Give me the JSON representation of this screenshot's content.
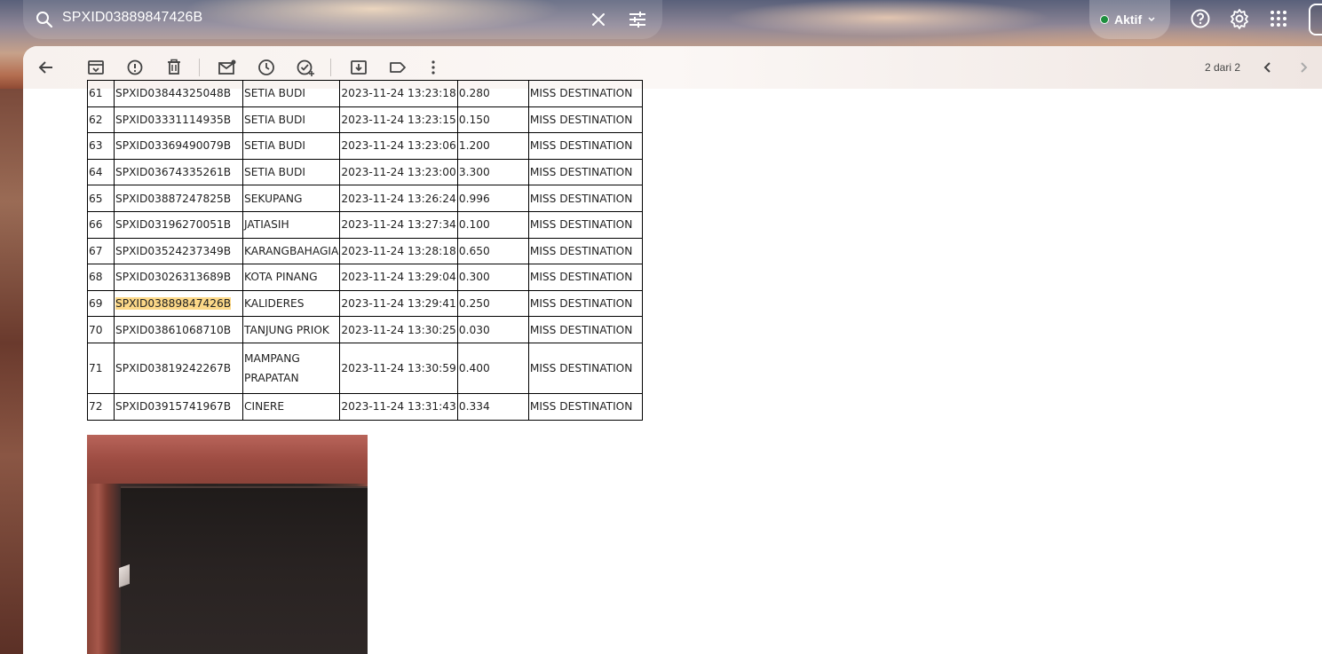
{
  "search": {
    "query": "SPXID03889847426B"
  },
  "status": {
    "label": "Aktif"
  },
  "pager": {
    "text": "2 dari 2"
  },
  "table": {
    "rows": [
      {
        "no": "61",
        "id": "SPXID03844325048B",
        "loc": "SETIA BUDI",
        "time": "2023-11-24 13:23:18",
        "weight": "0.280",
        "status": "MISS DESTINATION"
      },
      {
        "no": "62",
        "id": "SPXID03331114935B",
        "loc": "SETIA BUDI",
        "time": "2023-11-24 13:23:15",
        "weight": "0.150",
        "status": "MISS DESTINATION"
      },
      {
        "no": "63",
        "id": "SPXID03369490079B",
        "loc": "SETIA BUDI",
        "time": "2023-11-24 13:23:06",
        "weight": "1.200",
        "status": "MISS DESTINATION"
      },
      {
        "no": "64",
        "id": "SPXID03674335261B",
        "loc": "SETIA BUDI",
        "time": "2023-11-24 13:23:00",
        "weight": "3.300",
        "status": "MISS DESTINATION"
      },
      {
        "no": "65",
        "id": "SPXID03887247825B",
        "loc": "SEKUPANG",
        "time": "2023-11-24 13:26:24",
        "weight": "0.996",
        "status": "MISS DESTINATION"
      },
      {
        "no": "66",
        "id": "SPXID03196270051B",
        "loc": "JATIASIH",
        "time": "2023-11-24 13:27:34",
        "weight": "0.100",
        "status": "MISS DESTINATION"
      },
      {
        "no": "67",
        "id": "SPXID03524237349B",
        "loc": "KARANGBAHAGIA",
        "time": "2023-11-24 13:28:18",
        "weight": "0.650",
        "status": "MISS DESTINATION"
      },
      {
        "no": "68",
        "id": "SPXID03026313689B",
        "loc": "KOTA PINANG",
        "time": "2023-11-24 13:29:04",
        "weight": "0.300",
        "status": "MISS DESTINATION"
      },
      {
        "no": "69",
        "id": "SPXID03889847426B",
        "loc": "KALIDERES",
        "time": "2023-11-24 13:29:41",
        "weight": "0.250",
        "status": "MISS DESTINATION"
      },
      {
        "no": "70",
        "id": "SPXID03861068710B",
        "loc": "TANJUNG PRIOK",
        "time": "2023-11-24 13:30:25",
        "weight": "0.030",
        "status": "MISS DESTINATION"
      },
      {
        "no": "71",
        "id": "SPXID03819242267B",
        "loc": "MAMPANG PRAPATAN",
        "time": "2023-11-24 13:30:59",
        "weight": "0.400",
        "status": "MISS DESTINATION"
      },
      {
        "no": "72",
        "id": "SPXID03915741967B",
        "loc": "CINERE",
        "time": "2023-11-24 13:31:43",
        "weight": "0.334",
        "status": "MISS DESTINATION"
      }
    ]
  },
  "icons": {
    "search": "search-icon",
    "clear": "close-icon",
    "filter": "tune-icon",
    "help": "help-icon",
    "settings": "gear-icon",
    "apps": "apps-grid-icon"
  },
  "colors": {
    "highlight": "#fcd888",
    "status_active": "#1e8e3e"
  }
}
